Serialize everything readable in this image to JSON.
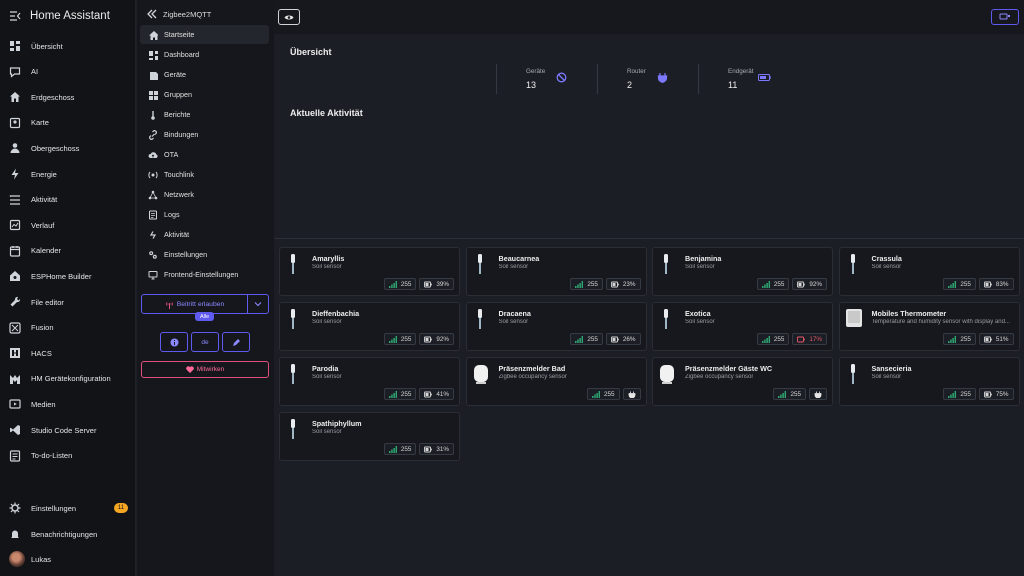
{
  "ha": {
    "title": "Home Assistant",
    "items": [
      {
        "label": "Übersicht",
        "icon": "dashboard-icon"
      },
      {
        "label": "AI",
        "icon": "chat-icon"
      },
      {
        "label": "Erdgeschoss",
        "icon": "home-icon"
      },
      {
        "label": "Karte",
        "icon": "map-icon"
      },
      {
        "label": "Obergeschoss",
        "icon": "person-icon"
      },
      {
        "label": "Energie",
        "icon": "lightning-icon"
      },
      {
        "label": "Aktivität",
        "icon": "list-icon"
      },
      {
        "label": "Verlauf",
        "icon": "chart-icon"
      },
      {
        "label": "Kalender",
        "icon": "calendar-icon"
      },
      {
        "label": "ESPHome Builder",
        "icon": "esphome-icon"
      },
      {
        "label": "File editor",
        "icon": "wrench-icon"
      },
      {
        "label": "Fusion",
        "icon": "fusion-icon"
      },
      {
        "label": "HACS",
        "icon": "hacs-icon"
      },
      {
        "label": "HM Gerätekonfiguration",
        "icon": "hm-icon"
      },
      {
        "label": "Medien",
        "icon": "media-icon"
      },
      {
        "label": "Studio Code Server",
        "icon": "vscode-icon"
      },
      {
        "label": "To-do-Listen",
        "icon": "todo-icon"
      }
    ],
    "bottom": {
      "settings": "Einstellungen",
      "settings_badge": "11",
      "notifications": "Benachrichtigungen",
      "user": "Lukas"
    }
  },
  "z2m": {
    "title": "Zigbee2MQTT",
    "items": [
      {
        "label": "Startseite",
        "icon": "home-icon",
        "active": true
      },
      {
        "label": "Dashboard",
        "icon": "dashboard-icon"
      },
      {
        "label": "Geräte",
        "icon": "devices-icon"
      },
      {
        "label": "Gruppen",
        "icon": "groups-icon"
      },
      {
        "label": "Berichte",
        "icon": "reports-icon"
      },
      {
        "label": "Bindungen",
        "icon": "link-icon"
      },
      {
        "label": "OTA",
        "icon": "cloud-upload-icon"
      },
      {
        "label": "Touchlink",
        "icon": "touchlink-icon"
      },
      {
        "label": "Netzwerk",
        "icon": "network-icon"
      },
      {
        "label": "Logs",
        "icon": "logs-icon"
      },
      {
        "label": "Aktivität",
        "icon": "activity-icon"
      },
      {
        "label": "Einstellungen",
        "icon": "settings-icon"
      },
      {
        "label": "Frontend-Einstellungen",
        "icon": "monitor-icon"
      }
    ],
    "permit_join": "Beitritt erlauben",
    "permit_scope": "Alle",
    "language": "de",
    "donate": "Mitwirken"
  },
  "main": {
    "overview_title": "Übersicht",
    "stats": [
      {
        "label": "Geräte",
        "value": "13"
      },
      {
        "label": "Router",
        "value": "2"
      },
      {
        "label": "Endgerät",
        "value": "11"
      }
    ],
    "activity_title": "Aktuelle Aktivität",
    "devices": [
      {
        "name": "Amaryllis",
        "desc": "Soil sensor",
        "lqi": "255",
        "battery": "39%",
        "type": "soil"
      },
      {
        "name": "Beaucarnea",
        "desc": "Soil sensor",
        "lqi": "255",
        "battery": "23%",
        "type": "soil"
      },
      {
        "name": "Benjamina",
        "desc": "Soil sensor",
        "lqi": "255",
        "battery": "92%",
        "type": "soil"
      },
      {
        "name": "Crassula",
        "desc": "Soil sensor",
        "lqi": "255",
        "battery": "83%",
        "type": "soil"
      },
      {
        "name": "Dieffenbachia",
        "desc": "Soil sensor",
        "lqi": "255",
        "battery": "92%",
        "type": "soil"
      },
      {
        "name": "Dracaena",
        "desc": "Soil sensor",
        "lqi": "255",
        "battery": "26%",
        "type": "soil"
      },
      {
        "name": "Exotica",
        "desc": "Soil sensor",
        "lqi": "255",
        "battery": "17%",
        "type": "soil",
        "low": true
      },
      {
        "name": "Mobiles Thermometer",
        "desc": "Temperature and humidity sensor with display and...",
        "lqi": "255",
        "battery": "51%",
        "type": "thermo"
      },
      {
        "name": "Parodia",
        "desc": "Soil sensor",
        "lqi": "255",
        "battery": "41%",
        "type": "soil"
      },
      {
        "name": "Präsenzmelder Bad",
        "desc": "Zigbee occupancy sensor",
        "lqi": "255",
        "battery": "",
        "type": "occupancy"
      },
      {
        "name": "Präsenzmelder Gäste WC",
        "desc": "Zigbee occupancy sensor",
        "lqi": "255",
        "battery": "",
        "type": "occupancy"
      },
      {
        "name": "Sansecieria",
        "desc": "Soil sensor",
        "lqi": "255",
        "battery": "75%",
        "type": "soil"
      },
      {
        "name": "Spathiphyllum",
        "desc": "Soil sensor",
        "lqi": "255",
        "battery": "31%",
        "type": "soil"
      }
    ]
  },
  "colors": {
    "accent": "#5f5af0",
    "signal": "#2fa572",
    "low_battery": "#e9586a",
    "badge": "#f5a623"
  }
}
